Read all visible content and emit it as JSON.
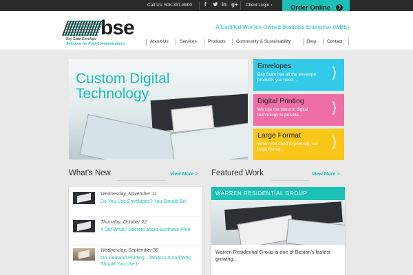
{
  "topbar": {
    "phone": "Call Us: 508-337-8900",
    "client_login": "Client Login ›",
    "order_online": "Order Online",
    "social": [
      "facebook-icon",
      "twitter-icon",
      "linkedin-icon",
      "google-plus-icon"
    ]
  },
  "header": {
    "logo_letters": "bse",
    "logo_tagline_1": "Bay State Envelope",
    "logo_tagline_2": "Solutions for Print Communications",
    "wbe": "A Certified Women-Owned Business Enterprise (WBE)",
    "nav": [
      "About Us",
      "Services",
      "Products",
      "Community & Sustainability",
      "Blog",
      "Contact"
    ]
  },
  "hero": {
    "title_line1": "Custom Digital",
    "title_line2": "Technology"
  },
  "tiles": [
    {
      "title": "Envelopes",
      "text": "Bay State has all the envelope products you need...",
      "color": "#33c9e8"
    },
    {
      "title": "Digital Printing",
      "text": "We use the latest in digital technology to provide...",
      "color": "#ee6fa6"
    },
    {
      "title": "Large Format",
      "text": "When you need to print big, our large format...",
      "color": "#f8c71a"
    }
  ],
  "whats_new": {
    "heading": "What's New",
    "view_more": "View More >",
    "items": [
      {
        "date": "Wednesday, November 11",
        "title": "Do You Use Envelopes? You Should Be!"
      },
      {
        "date": "Thursday, October 22",
        "title": "It Did What? Secrets about Business Print"
      },
      {
        "date": "Wednesday, September 30",
        "title": "On-Demand Printing – What Is It And Why Should You Use It"
      }
    ]
  },
  "featured": {
    "heading": "Featured Work",
    "view_more": "View More >",
    "project": "WARREN RESIDENTIAL GROUP",
    "description": "Warren Residential Group is one of Boston's fastest growing..."
  },
  "colors": {
    "accent": "#1bc0b6",
    "dark": "#2a2a2a"
  }
}
